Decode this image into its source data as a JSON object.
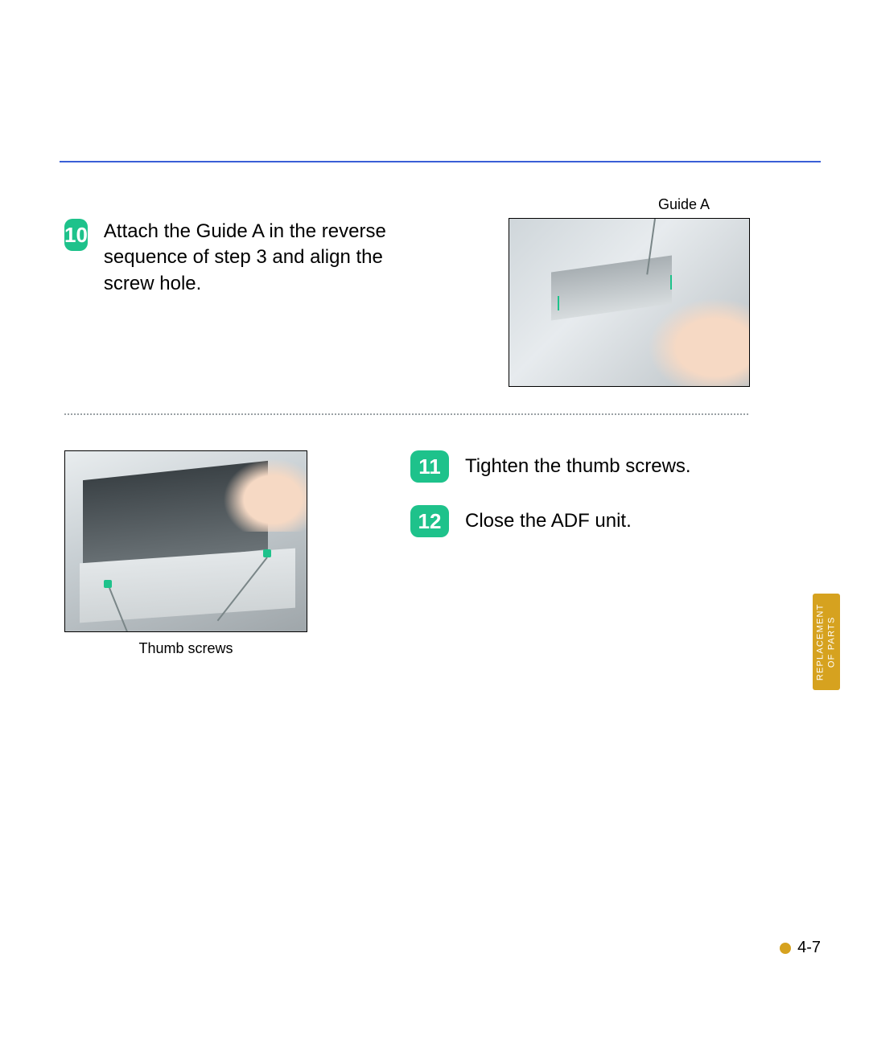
{
  "hr_color": "#3a5fd6",
  "steps": {
    "s10": {
      "num": "10",
      "text": "Attach the Guide A in the reverse sequence of step 3 and align the screw hole."
    },
    "s11": {
      "num": "11",
      "text": "Tighten the thumb screws."
    },
    "s12": {
      "num": "12",
      "text": "Close the ADF unit."
    }
  },
  "figures": {
    "fig1": {
      "caption": "Guide A"
    },
    "fig2": {
      "caption": "Thumb screws"
    }
  },
  "sidetab": {
    "line1": "REPLACEMENT",
    "line2": "OF PARTS"
  },
  "page_number": "4-7"
}
